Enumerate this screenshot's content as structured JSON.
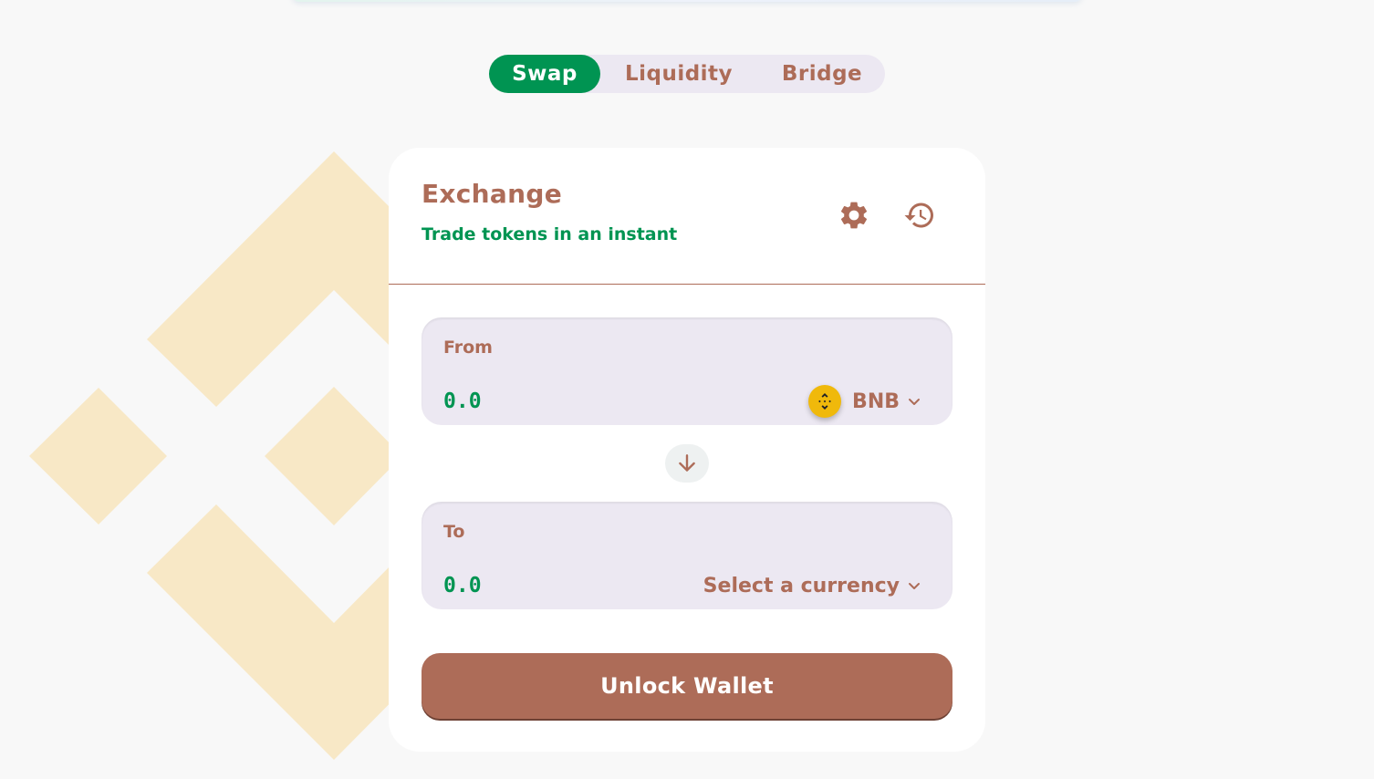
{
  "tabs": [
    {
      "label": "Swap",
      "active": true
    },
    {
      "label": "Liquidity",
      "active": false
    },
    {
      "label": "Bridge",
      "active": false
    }
  ],
  "exchange": {
    "title": "Exchange",
    "subtitle": "Trade tokens in an instant",
    "settings_icon": "gear-icon",
    "history_icon": "history-icon"
  },
  "from": {
    "label": "From",
    "amount_placeholder": "0.0",
    "currency": "BNB",
    "currency_icon": "bnb-coin-icon"
  },
  "to": {
    "label": "To",
    "amount_placeholder": "0.0",
    "currency": "Select a currency"
  },
  "swap_direction_icon": "arrow-down-icon",
  "unlock_button": "Unlock Wallet",
  "colors": {
    "primary_green": "#009452",
    "brown": "#ad6c58",
    "panel_bg": "#ece8f2",
    "logo_bg": "#f8e8c6",
    "bnb_yellow": "#f0b90b"
  }
}
